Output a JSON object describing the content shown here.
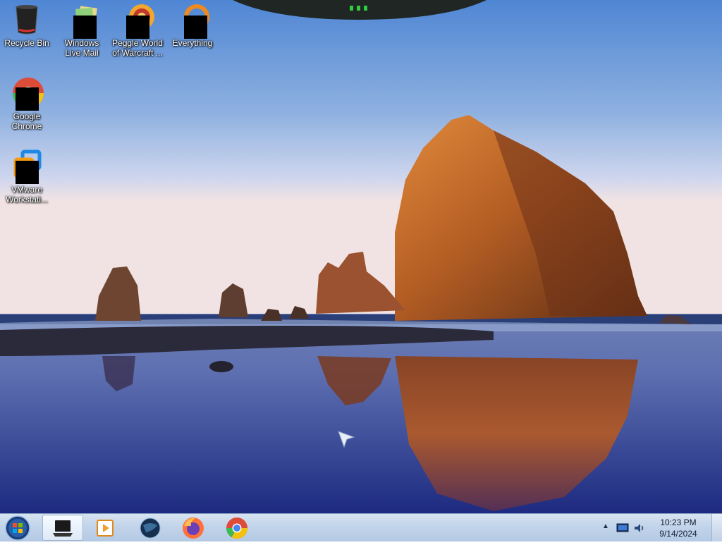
{
  "desktop": {
    "icons": [
      {
        "label": "Recycle Bin"
      },
      {
        "label": "Windows Live Mail"
      },
      {
        "label": "Peggle World of Warcraft ..."
      },
      {
        "label": "Everything"
      },
      {
        "label": "Google Chrome"
      },
      {
        "label": "VMware Workstati..."
      }
    ]
  },
  "taskbar": {
    "pinned": [
      {
        "icon": "laptop-app-icon",
        "active": true
      },
      {
        "icon": "media-player-icon",
        "active": false
      },
      {
        "icon": "globe-icon",
        "active": false
      },
      {
        "icon": "firefox-icon",
        "active": false
      },
      {
        "icon": "chrome-icon",
        "active": false
      }
    ],
    "tray": {
      "time": "10:23 PM",
      "date": "9/14/2024"
    }
  },
  "colors": {
    "sky_top": "#5e8fd6",
    "sky_horizon": "#f0e6e8",
    "rock": "#c8702a",
    "water": "#3a4f9a",
    "taskbar": "#c2d4ea"
  }
}
